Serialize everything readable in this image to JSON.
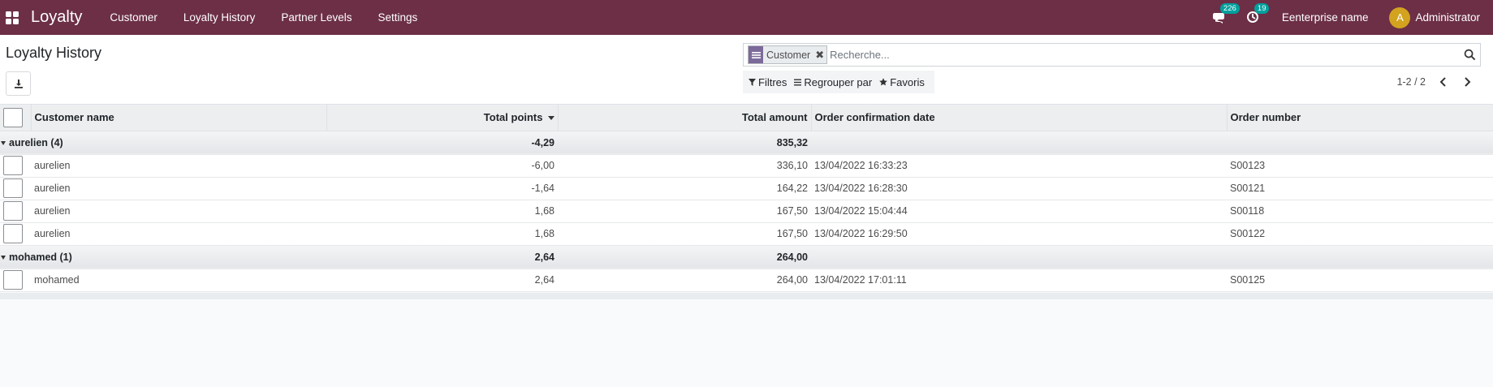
{
  "navbar": {
    "brand": "Loyalty",
    "menu": [
      "Customer",
      "Loyalty History",
      "Partner Levels",
      "Settings"
    ],
    "messages_count": "226",
    "activities_count": "19",
    "company": "Eenterprise name",
    "avatar_letter": "A",
    "user": "Administrator"
  },
  "control": {
    "title": "Loyalty History",
    "facet_label": "Customer",
    "search_placeholder": "Recherche...",
    "filters_label": "Filtres",
    "groupby_label": "Regrouper par",
    "favorites_label": "Favoris",
    "pager": "1-2 / 2"
  },
  "table": {
    "columns": {
      "customer": "Customer name",
      "points": "Total points",
      "amount": "Total amount",
      "date": "Order confirmation date",
      "order": "Order number"
    },
    "groups": [
      {
        "label": "aurelien (4)",
        "points": "-4,29",
        "amount": "835,32",
        "rows": [
          {
            "customer": "aurelien",
            "points": "-6,00",
            "amount": "336,10",
            "date": "13/04/2022 16:33:23",
            "order": "S00123"
          },
          {
            "customer": "aurelien",
            "points": "-1,64",
            "amount": "164,22",
            "date": "13/04/2022 16:28:30",
            "order": "S00121"
          },
          {
            "customer": "aurelien",
            "points": "1,68",
            "amount": "167,50",
            "date": "13/04/2022 15:04:44",
            "order": "S00118"
          },
          {
            "customer": "aurelien",
            "points": "1,68",
            "amount": "167,50",
            "date": "13/04/2022 16:29:50",
            "order": "S00122"
          }
        ]
      },
      {
        "label": "mohamed (1)",
        "points": "2,64",
        "amount": "264,00",
        "rows": [
          {
            "customer": "mohamed",
            "points": "2,64",
            "amount": "264,00",
            "date": "13/04/2022 17:01:11",
            "order": "S00125"
          }
        ]
      }
    ]
  },
  "colors": {
    "navbar": "#6c2f46",
    "badge": "#00a09d",
    "avatar": "#d3a21f",
    "facet": "#7c6a9a"
  }
}
